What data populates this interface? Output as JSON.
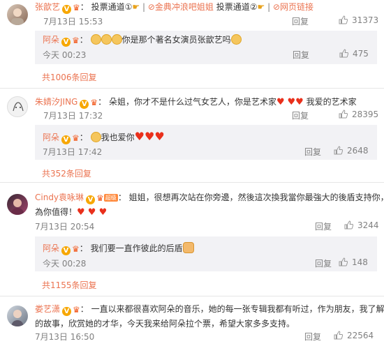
{
  "comments": [
    {
      "user": "张歆艺",
      "content_parts": [
        "投票通道①",
        "金典冲浪吧姐姐",
        "投票通道②",
        "网页链接"
      ],
      "time": "7月13日 15:53",
      "reply_label": "回复",
      "likes": "31373",
      "reply": {
        "user": "阿朵",
        "text": "你是那个著名女演员张歆艺吗",
        "time": "今天 00:23",
        "reply_label": "回复",
        "likes": "475"
      },
      "more": "共1006条回复"
    },
    {
      "user": "朱婧汐JING",
      "text": "朵姐，你才不是什么过气女艺人，你是艺术家",
      "text2": "我爱的艺术家",
      "time": "7月13日 17:32",
      "reply_label": "回复",
      "likes": "28395",
      "reply": {
        "user": "阿朵",
        "text": "我也爱你",
        "time": "7月13日 17:42",
        "reply_label": "回复",
        "likes": "2648"
      },
      "more": "共352条回复"
    },
    {
      "user": "Cindy袁咏琳",
      "level": "超级",
      "text": "姐姐，很想再次站在你旁邊，然後這次換我當你最強大的後盾支持你，因",
      "text2": "為你值得！",
      "time": "7月13日 20:54",
      "reply_label": "回复",
      "likes": "3244",
      "reply": {
        "user": "阿朵",
        "text": "我们要一直作彼此的后盾",
        "time": "今天 00:28",
        "reply_label": "回复",
        "likes": "148"
      },
      "more": "共1155条回复"
    },
    {
      "user": "娄艺潇",
      "text": "一直以来都很喜欢阿朵的音乐，她的每一张专辑我都有听过，作为朋友，我了解她",
      "text2": "的故事，欣赏她的才华，今天我来给阿朵拉个票，希望大家多多支持。",
      "time": "7月13日 16:50",
      "reply_label": "回复",
      "likes": "22564"
    }
  ],
  "colors": {
    "accent": "#eb7350",
    "muted": "#808080",
    "reply_bg": "#f2f2f5",
    "heart": "#e9301c",
    "v_badge": "#f7a700"
  },
  "icons": {
    "like": "thumbs-up-icon",
    "v": "verified-v-icon",
    "vip": "vip-crown-icon",
    "heart": "heart-icon",
    "link": "link-icon"
  }
}
